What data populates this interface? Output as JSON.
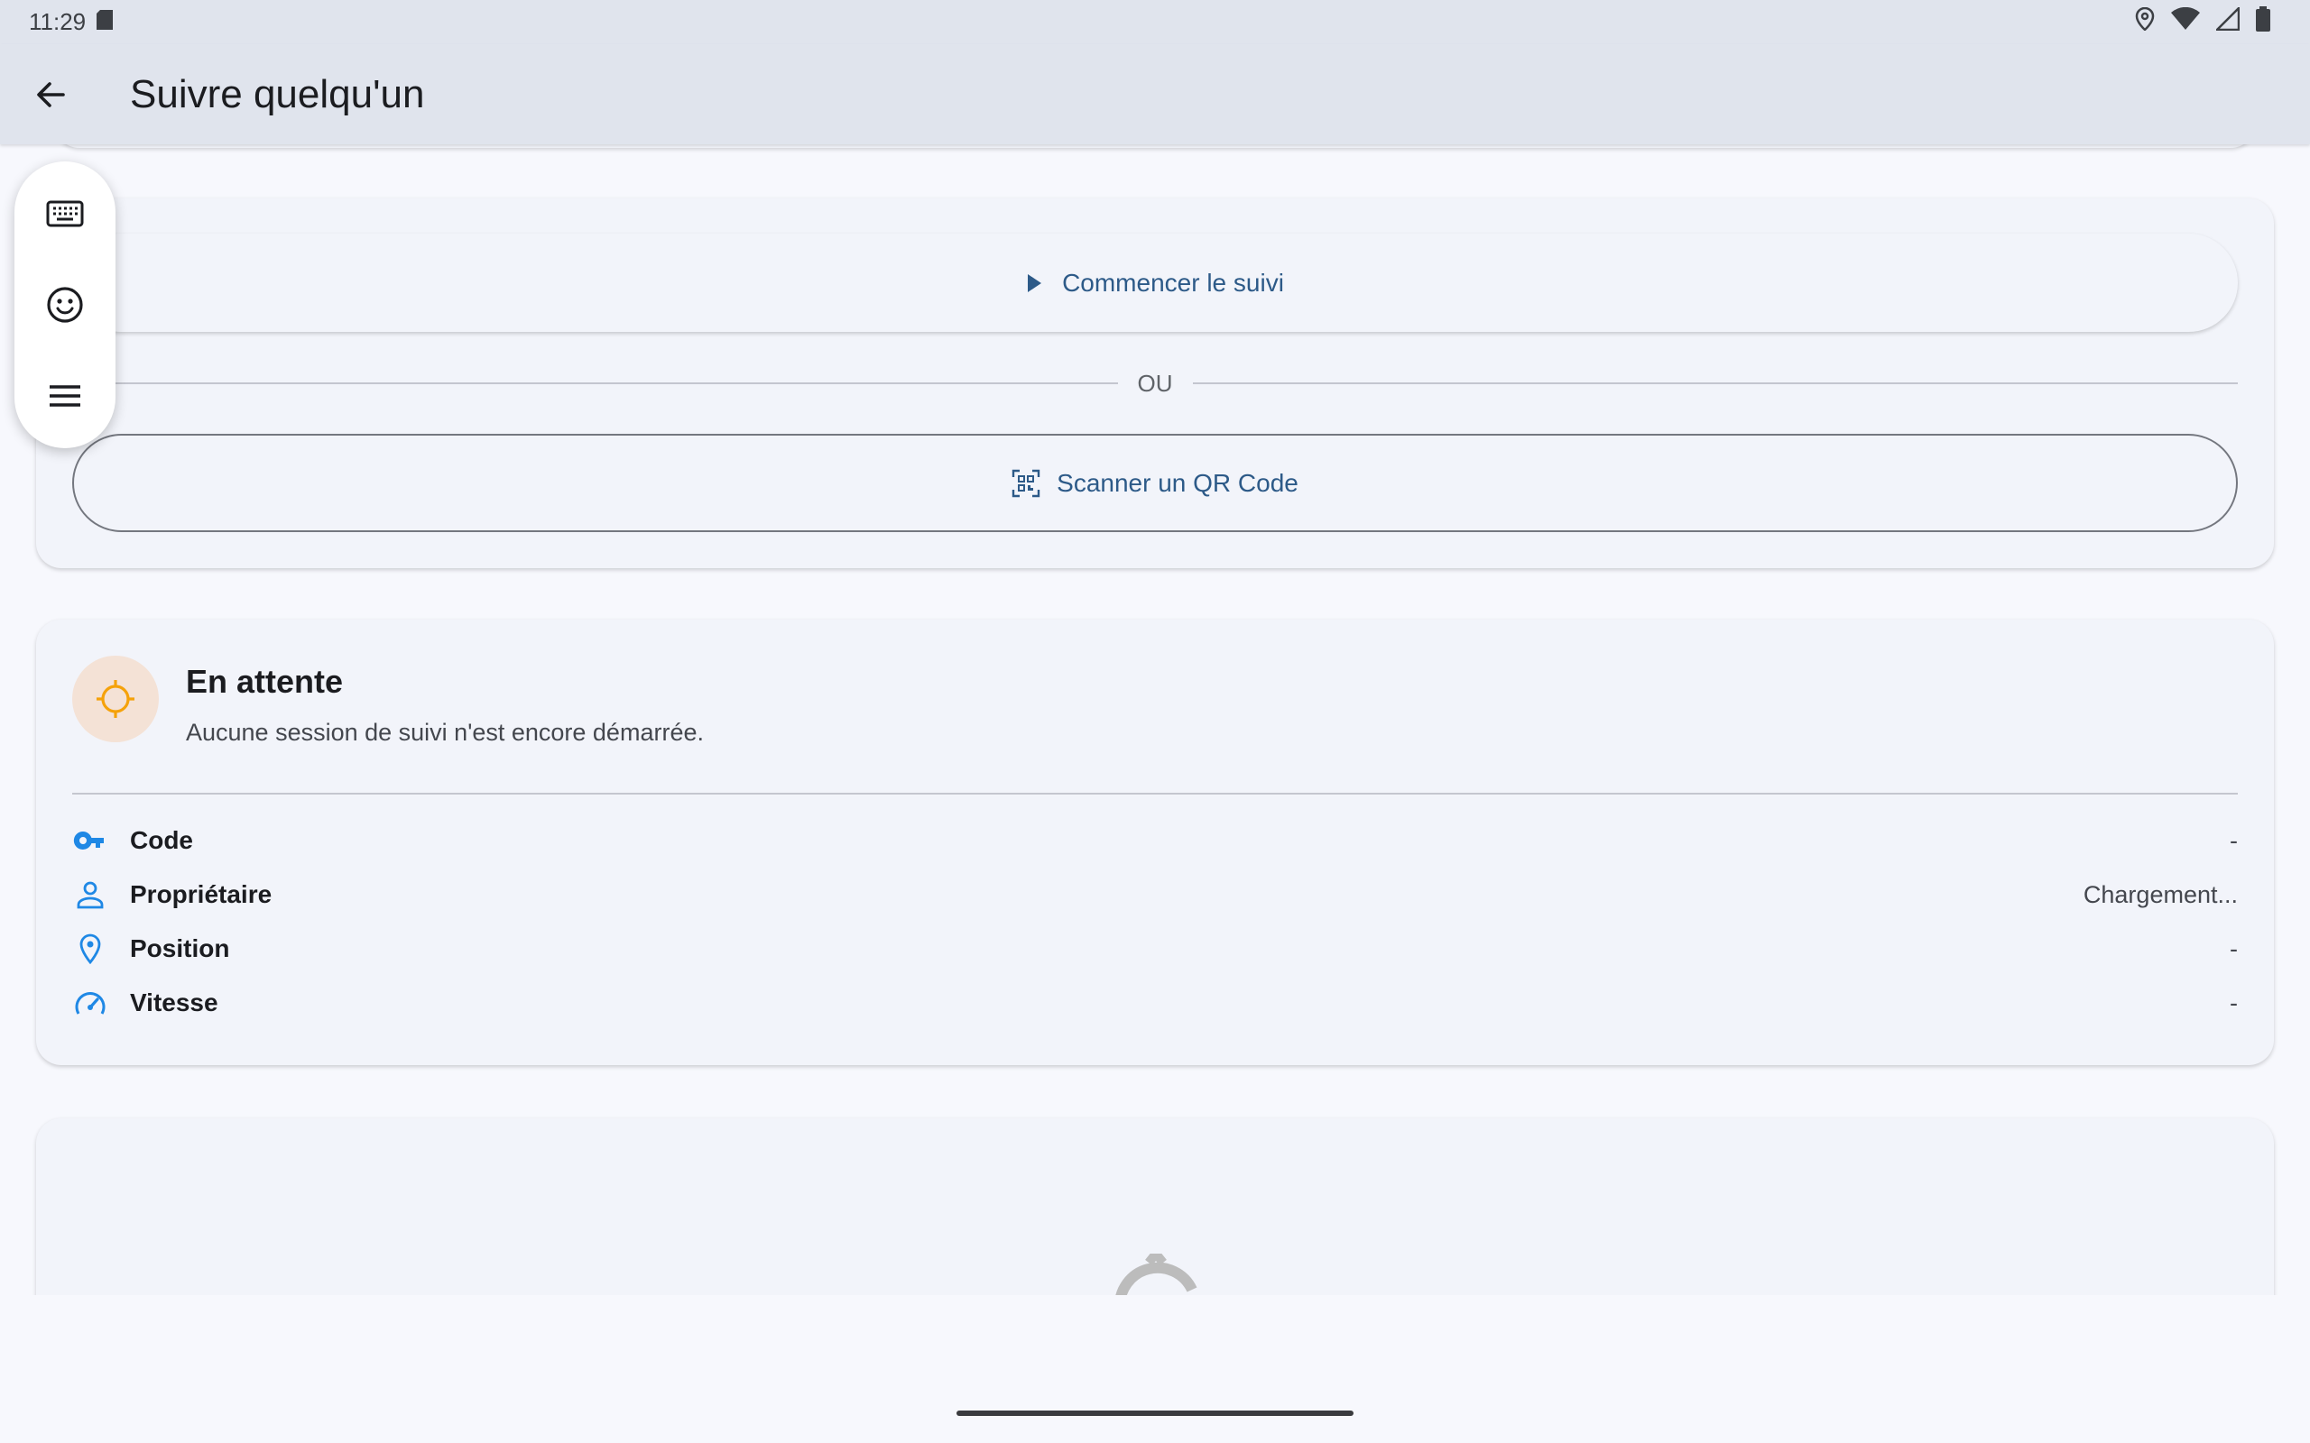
{
  "status_bar": {
    "time": "11:29",
    "icons": [
      "sd-card-icon",
      "location-icon",
      "wifi-icon",
      "signal-icon",
      "battery-icon"
    ]
  },
  "app_bar": {
    "back_icon": "arrow-back-icon",
    "title": "Suivre quelqu'un"
  },
  "keyboard_panel": {
    "items": [
      "keyboard-icon",
      "emoji-icon",
      "menu-icon"
    ]
  },
  "actions_card": {
    "start_button": {
      "label": "Commencer le suivi",
      "icon": "play-icon"
    },
    "divider_text": "OU",
    "qr_button": {
      "label": "Scanner un QR Code",
      "icon": "qr-scan-icon"
    }
  },
  "status_card": {
    "title": "En attente",
    "subtitle": "Aucune session de suivi n'est encore démarrée.",
    "icon": "crosshair-icon",
    "rows": [
      {
        "label": "Code",
        "value": "-",
        "icon": "key-icon"
      },
      {
        "label": "Propriétaire",
        "value": "Chargement...",
        "icon": "person-icon"
      },
      {
        "label": "Position",
        "value": "-",
        "icon": "location-pin-icon"
      },
      {
        "label": "Vitesse",
        "value": "-",
        "icon": "speedometer-icon"
      }
    ]
  },
  "colors": {
    "app_bar_bg": "#e0e4ed",
    "card_bg": "#f2f4fa",
    "accent_blue": "#1f88e5",
    "button_text": "#2d5a88",
    "orange_icon": "#f5a20a",
    "avatar_bg": "#f4e2d6"
  }
}
